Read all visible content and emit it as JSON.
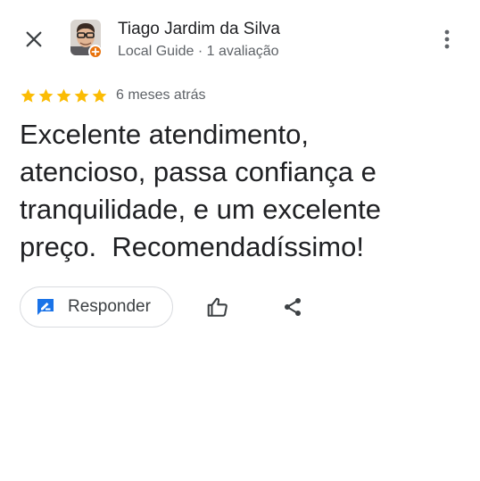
{
  "reviewer": {
    "name": "Tiago Jardim da Silva",
    "meta": "Local Guide · 1 avaliação"
  },
  "review": {
    "rating": 5,
    "rating_max": 5,
    "time": "6 meses atrás",
    "text": "Excelente atendimento,\natencioso, passa confiança e\ntranquilidade, e um excelente\npreço.  Recomendadíssimo!"
  },
  "actions": {
    "reply_label": "Responder"
  },
  "icons": {
    "close": "close-icon",
    "more": "more-vert-icon",
    "star": "star-icon",
    "reply": "reply-edit-icon",
    "like": "thumb-up-icon",
    "share": "share-icon",
    "badge": "local-guide-badge-icon"
  },
  "colors": {
    "star": "#fbbc04",
    "reply_icon": "#1a73e8",
    "badge": "#e8710a",
    "text_primary": "#202124",
    "text_secondary": "#5f6368"
  }
}
